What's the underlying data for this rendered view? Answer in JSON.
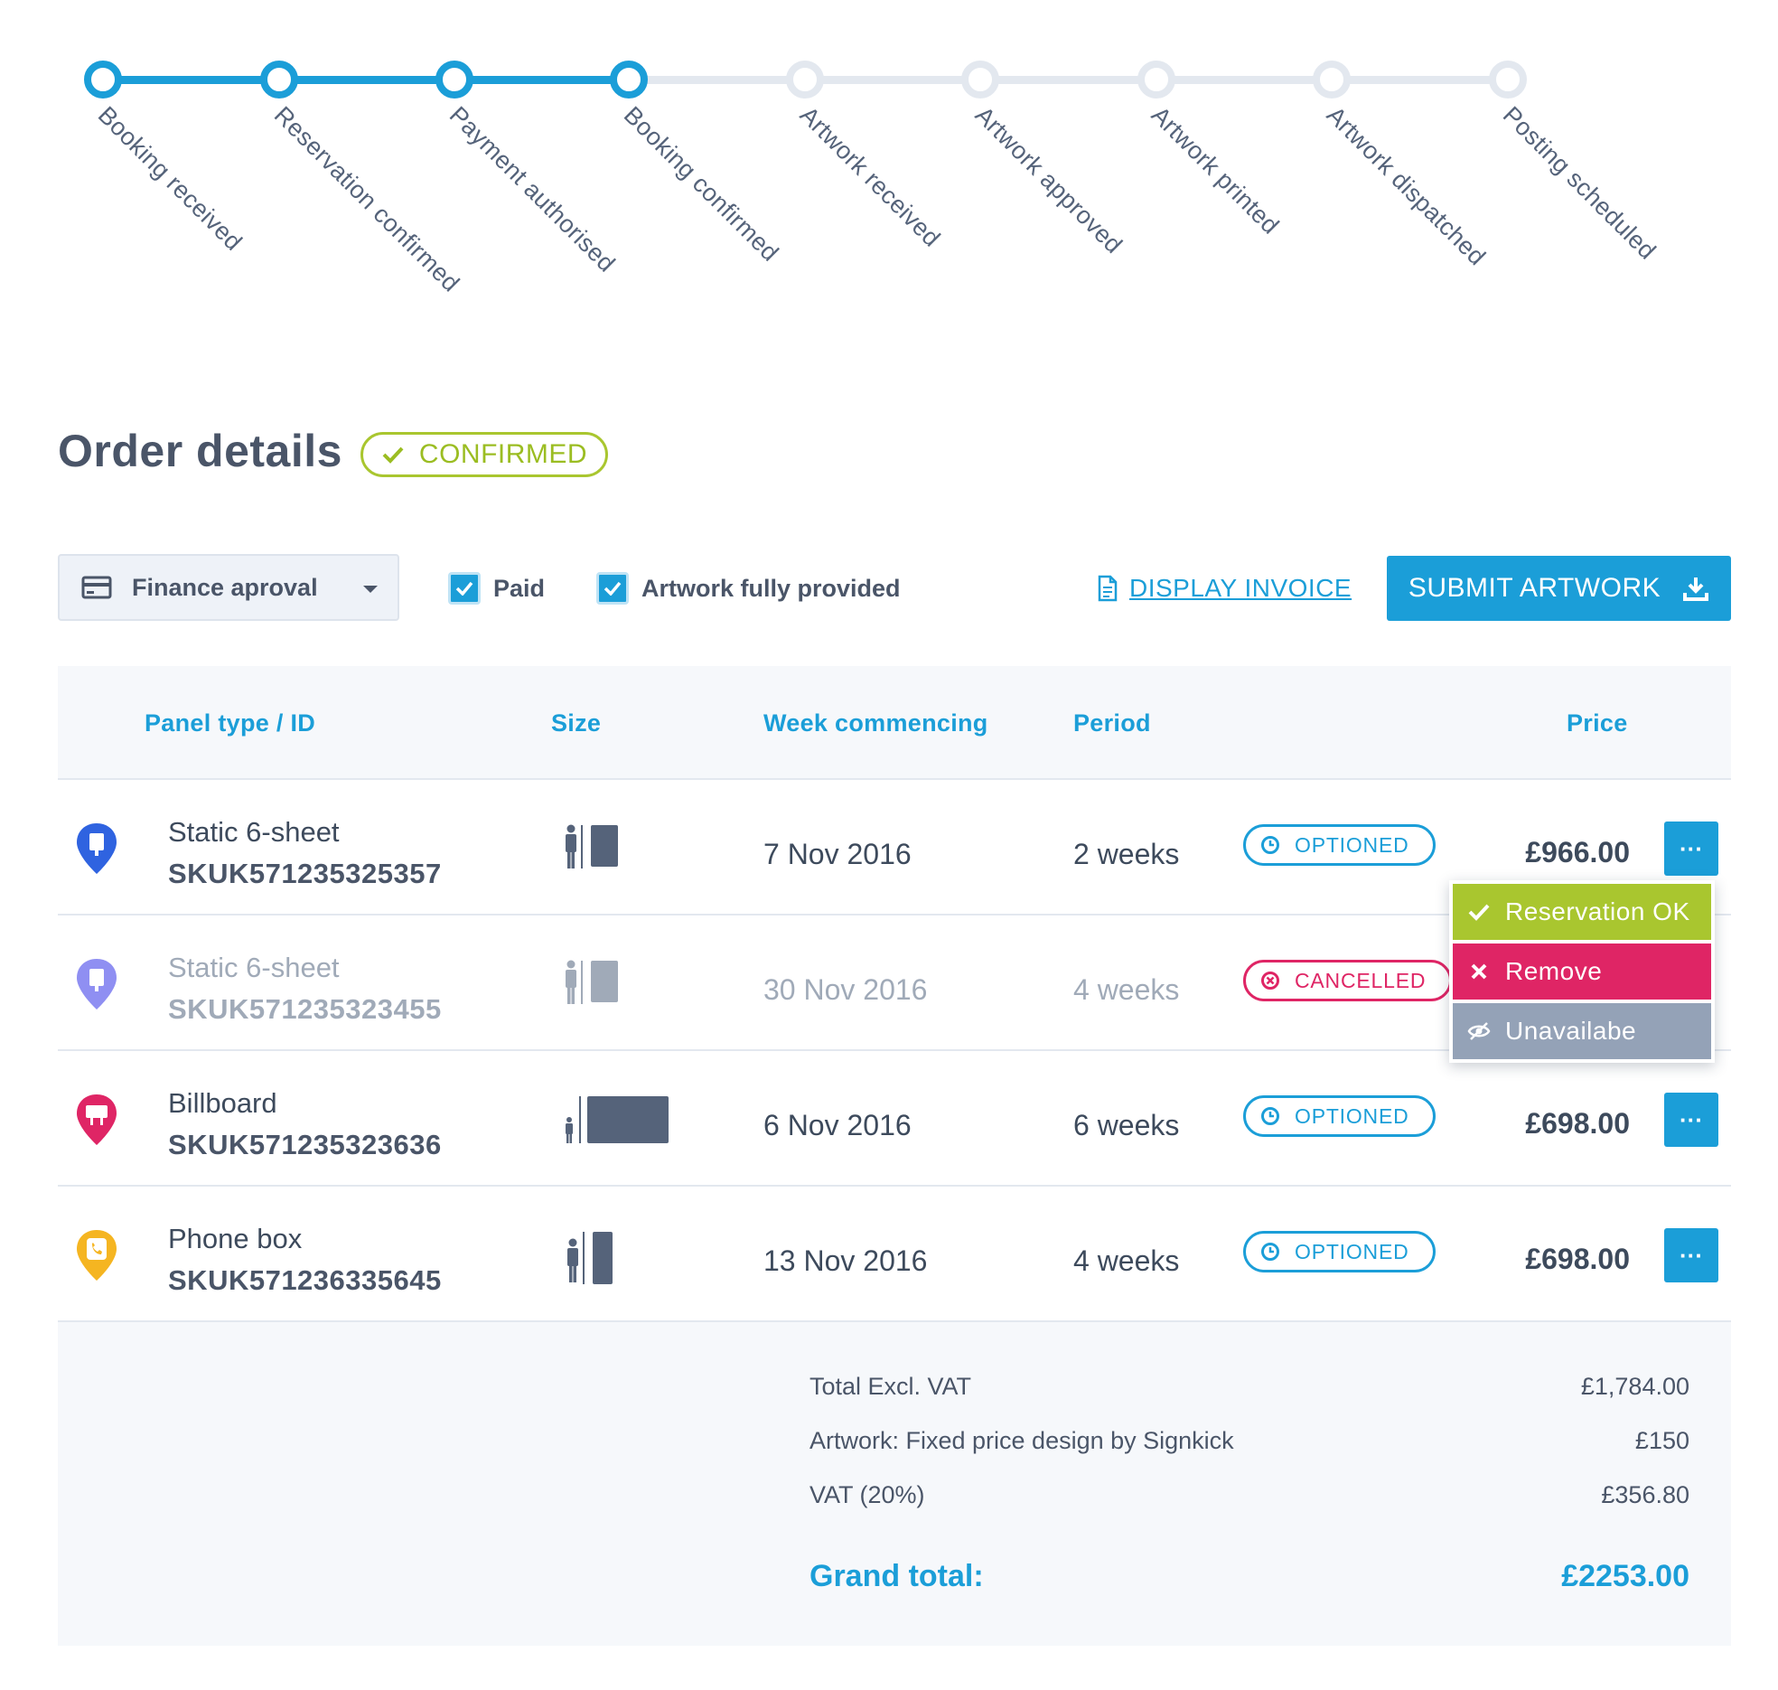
{
  "tracker": {
    "steps": [
      {
        "label": "Booking received",
        "done": true
      },
      {
        "label": "Reservation confirmed",
        "done": true
      },
      {
        "label": "Payment authorised",
        "done": true
      },
      {
        "label": "Booking confirmed",
        "done": true
      },
      {
        "label": "Artwork received",
        "done": false
      },
      {
        "label": "Artwork approved",
        "done": false
      },
      {
        "label": "Artwork printed",
        "done": false
      },
      {
        "label": "Artwork dispatched",
        "done": false
      },
      {
        "label": "Posting scheduled",
        "done": false
      }
    ]
  },
  "header": {
    "title": "Order details",
    "status": "CONFIRMED",
    "status_icon": "check-icon"
  },
  "toolbar": {
    "finance_select": {
      "selected": "Finance aproval",
      "icon": "credit-card-icon"
    },
    "paid": {
      "label": "Paid",
      "checked": true
    },
    "artwork_provided": {
      "label": "Artwork fully provided",
      "checked": true
    },
    "invoice_link": "DISPLAY INVOICE",
    "submit_label": "SUBMIT ARTWORK"
  },
  "table": {
    "headers": {
      "panel": "Panel type / ID",
      "size": "Size",
      "week": "Week commencing",
      "period": "Period",
      "price": "Price"
    },
    "rows": [
      {
        "panel_type": "Static 6-sheet",
        "id": "SKUK571235325357",
        "week": "7 Nov 2016",
        "period": "2 weeks",
        "status": "OPTIONED",
        "price": "£966.00",
        "pin_color": "#2f63e0",
        "size_kind": "6-sheet"
      },
      {
        "panel_type": "Static 6-sheet",
        "id": "SKUK571235323455",
        "week": "30 Nov 2016",
        "period": "4 weeks",
        "status": "CANCELLED",
        "price": "",
        "pin_color": "#8f8ff2",
        "size_kind": "6-sheet"
      },
      {
        "panel_type": "Billboard",
        "id": "SKUK571235323636",
        "week": "6 Nov 2016",
        "period": "6 weeks",
        "status": "OPTIONED",
        "price": "£698.00",
        "pin_color": "#df2565",
        "size_kind": "billboard"
      },
      {
        "panel_type": "Phone box",
        "id": "SKUK571236335645",
        "week": "13 Nov 2016",
        "period": "4 weeks",
        "status": "OPTIONED",
        "price": "£698.00",
        "pin_color": "#f5b521",
        "size_kind": "phone-box"
      }
    ],
    "more_label": "···"
  },
  "totals": {
    "excl_vat_label": "Total Excl. VAT",
    "excl_vat_value": "£1,784.00",
    "artwork_label": "Artwork: Fixed price design by Signkick",
    "artwork_value": "£150",
    "vat_label": "VAT (20%)",
    "vat_value": "£356.80",
    "grand_label": "Grand total:",
    "grand_value": "£2253.00"
  },
  "action_menu": {
    "items": [
      {
        "label": "Reservation OK",
        "icon": "check-icon",
        "color": "#a9c62f"
      },
      {
        "label": "Remove",
        "icon": "close-icon",
        "color": "#df2565"
      },
      {
        "label": "Unavailabe",
        "icon": "eye-slash-icon",
        "color": "#94a2b7"
      }
    ]
  },
  "colors": {
    "accent": "#1b9ed8",
    "confirmed": "#a9c62f",
    "cancelled": "#df2565",
    "muted": "#94a2b7"
  }
}
